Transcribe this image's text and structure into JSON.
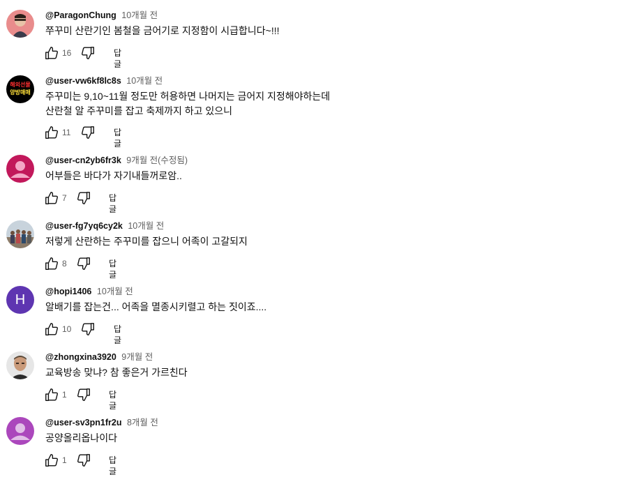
{
  "comments": [
    {
      "author": "@ParagonChung",
      "time": "10개월 전",
      "lines": [
        "쭈꾸미 산란기인 봄철을 금어기로 지정함이 시급합니다~!!!"
      ],
      "likes": "16",
      "reply_label": "답글",
      "avatar_icon": "photo-avatar"
    },
    {
      "author": "@user-vw6kf8lc8s",
      "time": "10개월 전",
      "lines": [
        "주꾸미는 9,10~11월 정도만 허용하면 나머지는 금어지 지정해야하는데",
        "산란철 알 주꾸미를 잡고 축제까지 하고 있으니"
      ],
      "likes": "11",
      "reply_label": "답글",
      "avatar_icon": "text-avatar",
      "avatar_text": [
        "해외선물",
        "양방매매"
      ]
    },
    {
      "author": "@user-cn2yb6fr3k",
      "time": "9개월 전(수정됨)",
      "lines": [
        "어부들은 바다가 자기내들꺼로암.."
      ],
      "likes": "7",
      "reply_label": "답글",
      "avatar_icon": "default-person-avatar"
    },
    {
      "author": "@user-fg7yq6cy2k",
      "time": "10개월 전",
      "lines": [
        "저렇게 산란하는 주꾸미를 잡으니 어족이 고갈되지"
      ],
      "likes": "8",
      "reply_label": "답글",
      "avatar_icon": "group-photo-avatar"
    },
    {
      "author": "@hopi1406",
      "time": "10개월 전",
      "lines": [
        "알배기를 잡는건... 어족을 멸종시키렬고 하는 짓이죠...."
      ],
      "likes": "10",
      "reply_label": "답글",
      "avatar_icon": "letter-avatar",
      "avatar_letter": "H"
    },
    {
      "author": "@zhongxina3920",
      "time": "9개월 전",
      "lines": [
        "교육방송 맞냐? 참 좋은거 가르친다"
      ],
      "likes": "1",
      "reply_label": "답글",
      "avatar_icon": "portrait-photo-avatar"
    },
    {
      "author": "@user-sv3pn1fr2u",
      "time": "8개월 전",
      "lines": [
        "공양올리옵나이다"
      ],
      "likes": "1",
      "reply_label": "답글",
      "avatar_icon": "default-person-avatar"
    }
  ],
  "colors": {
    "text": "#0f0f0f",
    "secondary": "#606060",
    "avatar_pink": "#c2185b",
    "avatar_purple": "#ab47bc",
    "avatar_indigo": "#5e35b1"
  }
}
